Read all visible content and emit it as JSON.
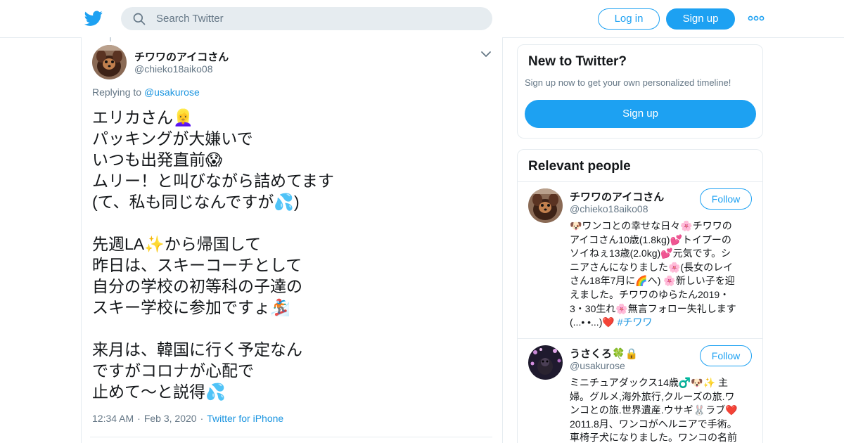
{
  "header": {
    "logo_icon": "twitter-bird-icon",
    "brand_color": "#1da1f2",
    "search": {
      "placeholder": "Search Twitter",
      "value": ""
    },
    "login_label": "Log in",
    "signup_label": "Sign up",
    "more_icon": "more-dots-icon"
  },
  "tweet": {
    "author_name": "チワワのアイコさん",
    "author_handle": "@chieko18aiko08",
    "replying_prefix": "Replying to",
    "replying_to": "@usakurose",
    "text_lines": [
      "エリカさん👱‍♀️",
      "パッキングが大嫌いで",
      "いつも出発直前😱",
      "ムリー！と叫びながら詰めてます",
      "(て、私も同じなんですが💦)",
      "",
      "先週LA✨から帰国して",
      "昨日は、スキーコーチとして",
      "自分の学校の初等科の子達の",
      "スキー学校に参加ですょ🏂",
      "",
      "来月は、韓国に行く予定なん",
      "ですがコロナが心配で",
      "止めて〜と説得💦"
    ],
    "time": "12:34 AM",
    "date": "Feb 3, 2020",
    "separator": "·",
    "source": "Twitter for iPhone"
  },
  "sidebar": {
    "new_to_twitter": {
      "title": "New to Twitter?",
      "subtitle": "Sign up now to get your own personalized timeline!",
      "button_label": "Sign up"
    },
    "relevant_people": {
      "title": "Relevant people",
      "people": [
        {
          "name": "チワワのアイコさん",
          "handle": "@chieko18aiko08",
          "follow_label": "Follow",
          "bio_lines": [
            "🐶ワンコとの幸せな日々🌸チワワの",
            "アイコさん10歳(1.8kg)💕トイプーの",
            "ソイねぇ13歳(2.0kg)💕元気です。シ",
            "ニアさんになりました🌸(長女のレイ",
            "さん18年7月に🌈へ) 🌸新しい子を迎",
            "えました。チワワのゆらたん2019・",
            "3・30生れ🌸無言フォロー失礼します",
            "(...• •...)❤️ "
          ],
          "bio_hashtag": "#チワワ"
        },
        {
          "name": "うさくろ🍀🔒",
          "handle": "@usakurose",
          "follow_label": "Follow",
          "bio_lines": [
            "ミニチュアダックス14歳♂️🐶✨ 主",
            "婦。グルメ,海外旅行,クルーズの旅.ワ",
            "ンコとの旅.世界遺産.ウサギ🐰ラブ❤️",
            "2011.8月、ワンコがヘルニアで手術。",
            "車椅子犬になりました。ワンコの名前"
          ]
        }
      ]
    }
  }
}
